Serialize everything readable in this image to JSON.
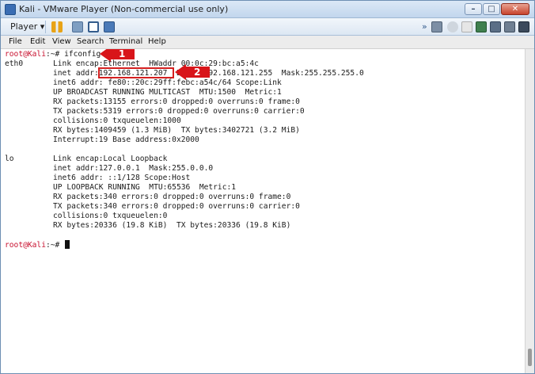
{
  "window": {
    "title": "Kali - VMware Player (Non-commercial use only)",
    "minimize_glyph": "–",
    "maximize_glyph": "□",
    "close_glyph": "✕"
  },
  "toolbar": {
    "player_label": "Player ▾"
  },
  "menu": {
    "items": [
      "File",
      "Edit",
      "View",
      "Search",
      "Terminal",
      "Help"
    ]
  },
  "terminal": {
    "prompt1": "root@Kali",
    "prompt1_suffix": ":~# ifconfig",
    "eth0_name": "eth0",
    "eth0_lines": [
      "Link encap:Ethernet  HWaddr 00:0c:29:bc:a5:4c",
      "inet addr:192.168.121.207  Bcast:192.168.121.255  Mask:255.255.255.0",
      "inet6 addr: fe80::20c:29ff:febc:a54c/64 Scope:Link",
      "UP BROADCAST RUNNING MULTICAST  MTU:1500  Metric:1",
      "RX packets:13155 errors:0 dropped:0 overruns:0 frame:0",
      "TX packets:5319 errors:0 dropped:0 overruns:0 carrier:0",
      "collisions:0 txqueuelen:1000",
      "RX bytes:1409459 (1.3 MiB)  TX bytes:3402721 (3.2 MiB)",
      "Interrupt:19 Base address:0x2000"
    ],
    "lo_name": "lo",
    "lo_lines": [
      "Link encap:Local Loopback",
      "inet addr:127.0.0.1  Mask:255.0.0.0",
      "inet6 addr: ::1/128 Scope:Host",
      "UP LOOPBACK RUNNING  MTU:65536  Metric:1",
      "RX packets:340 errors:0 dropped:0 overruns:0 frame:0",
      "TX packets:340 errors:0 dropped:0 overruns:0 carrier:0",
      "collisions:0 txqueuelen:0",
      "RX bytes:20336 (19.8 KiB)  TX bytes:20336 (19.8 KiB)"
    ],
    "prompt2": "root@Kali",
    "prompt2_suffix": ":~# "
  },
  "annotations": {
    "arrow1_number": "1",
    "arrow2_number": "2",
    "color": "#d8151a"
  }
}
